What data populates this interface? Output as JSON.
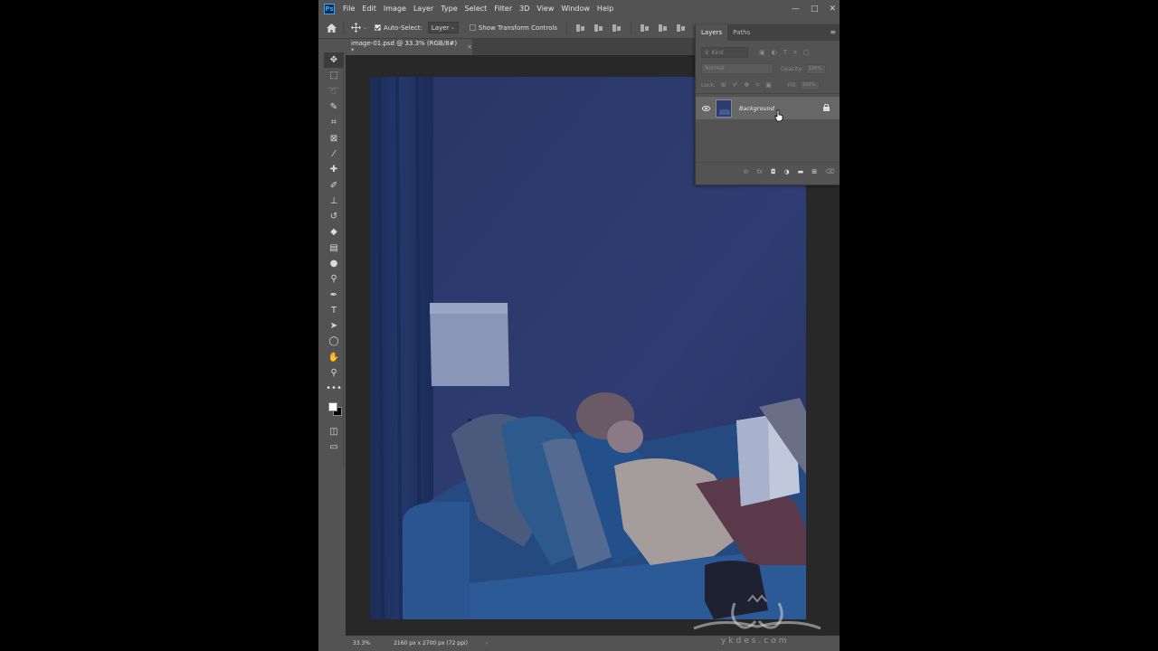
{
  "app": {
    "logo_text": "Ps",
    "menu": [
      "File",
      "Edit",
      "Image",
      "Layer",
      "Type",
      "Select",
      "Filter",
      "3D",
      "View",
      "Window",
      "Help"
    ],
    "window_controls": {
      "minimize": "—",
      "restore": "□",
      "close": "✕"
    }
  },
  "options_bar": {
    "auto_select_label": "Auto-Select:",
    "auto_select_checked": true,
    "target_value": "Layer",
    "show_transform_label": "Show Transform Controls",
    "show_transform_checked": false
  },
  "document": {
    "tab_title": "image-01.psd @ 33.3% (RGB/8#) *",
    "close_glyph": "×"
  },
  "status_bar": {
    "zoom": "33.3%",
    "doc_info": "2160 px x 2700 px (72 ppi)",
    "arrow": "›"
  },
  "tools": [
    "move-tool",
    "marquee-tool",
    "lasso-tool",
    "quick-selection-tool",
    "crop-tool",
    "frame-tool",
    "eyedropper-tool",
    "healing-brush-tool",
    "brush-tool",
    "clone-stamp-tool",
    "history-brush-tool",
    "eraser-tool",
    "gradient-tool",
    "blur-tool",
    "dodge-tool",
    "pen-tool",
    "type-tool",
    "path-selection-tool",
    "ellipse-tool",
    "hand-tool",
    "zoom-tool",
    "more-tools"
  ],
  "colors": {
    "foreground": "#ffffff",
    "background": "#000000",
    "canvas_tint": "#2c3a6c"
  },
  "layers_panel": {
    "tabs": [
      "Layers",
      "Paths"
    ],
    "active_tab": "Layers",
    "filter_placeholder": "Kind",
    "blend_mode": "Normal",
    "opacity_label": "Opacity:",
    "opacity_value": "100%",
    "lock_label": "Lock:",
    "fill_label": "Fill:",
    "fill_value": "100%",
    "layers": [
      {
        "name": "Background",
        "visible": true,
        "locked": true
      }
    ]
  },
  "watermark": {
    "text": "ykdes.com"
  }
}
